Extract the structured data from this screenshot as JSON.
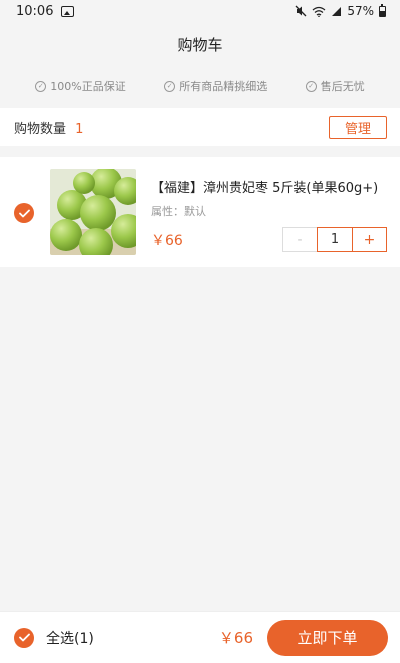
{
  "status": {
    "time": "10:06",
    "battery": "57%"
  },
  "header": {
    "title": "购物车"
  },
  "guarantees": [
    "100%正品保证",
    "所有商品精挑细选",
    "售后无忧"
  ],
  "cart": {
    "count_label": "购物数量",
    "count": "1",
    "manage_label": "管理"
  },
  "item": {
    "title": "【福建】漳州贵妃枣 5斤装(单果60g+)",
    "attr": "属性：默认",
    "price": "￥66",
    "quantity": "1",
    "minus": "-",
    "plus": "+"
  },
  "footer": {
    "select_all": "全选(1)",
    "total": "￥66",
    "order_button": "立即下单"
  },
  "colors": {
    "accent": "#e8632b"
  }
}
